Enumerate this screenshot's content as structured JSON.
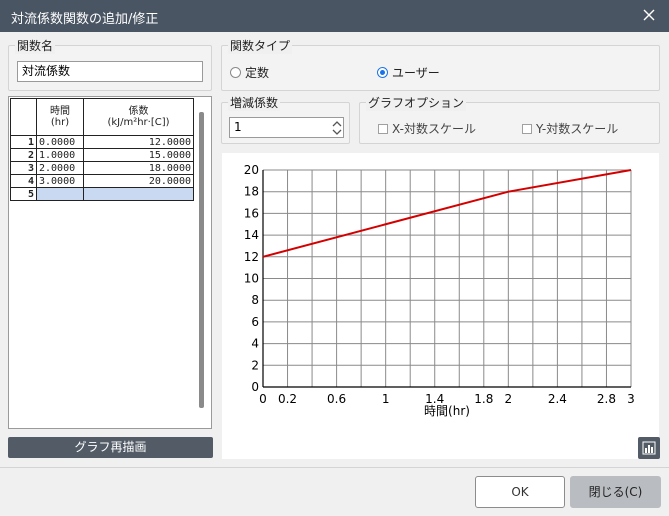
{
  "window": {
    "title": "対流係数関数の追加/修正"
  },
  "func_name": {
    "legend": "関数名",
    "value": "対流係数"
  },
  "func_type": {
    "legend": "関数タイプ",
    "options": [
      "定数",
      "ユーザー"
    ],
    "selected": "ユーザー"
  },
  "multiplier": {
    "legend": "増減係数",
    "value": "1"
  },
  "graph_options": {
    "legend": "グラフオプション",
    "x_log": "X-対数スケール",
    "y_log": "Y-対数スケール",
    "x_log_checked": false,
    "y_log_checked": false
  },
  "table": {
    "col1_line1": "時間",
    "col1_line2": "(hr)",
    "col2_line1": "係数",
    "col2_line2": "(kJ/m²hr·[C])",
    "rows": [
      {
        "n": "1",
        "t": "0.0000",
        "v": "12.0000"
      },
      {
        "n": "2",
        "t": "1.0000",
        "v": "15.0000"
      },
      {
        "n": "3",
        "t": "2.0000",
        "v": "18.0000"
      },
      {
        "n": "4",
        "t": "3.0000",
        "v": "20.0000"
      },
      {
        "n": "5",
        "t": "",
        "v": ""
      }
    ]
  },
  "buttons": {
    "redraw": "グラフ再描画",
    "ok": "OK",
    "close": "閉じる(C)"
  },
  "colors": {
    "line": "#d40000",
    "titlebar": "#4a5563",
    "accent": "#1a73e8"
  },
  "icons": {
    "close": "close-icon",
    "chart": "bar-chart-icon",
    "spin": "spin-arrows-icon"
  },
  "chart_data": {
    "type": "line",
    "xlabel": "時間(hr)",
    "ylabel": "",
    "x": [
      0,
      1,
      2,
      3
    ],
    "series": [
      {
        "values": [
          12,
          15,
          18,
          20
        ]
      }
    ],
    "xlim": [
      0,
      3
    ],
    "ylim": [
      0,
      20
    ],
    "x_tick_labels": [
      "0",
      "0.2",
      "0.6",
      "1",
      "1.4",
      "1.8",
      "2",
      "2.4",
      "2.8",
      "3"
    ],
    "x_tick_values": [
      0,
      0.2,
      0.6,
      1,
      1.4,
      1.8,
      2,
      2.4,
      2.8,
      3
    ],
    "y_ticks": [
      0,
      2,
      4,
      6,
      8,
      10,
      12,
      14,
      16,
      18,
      20
    ],
    "grid": true
  }
}
